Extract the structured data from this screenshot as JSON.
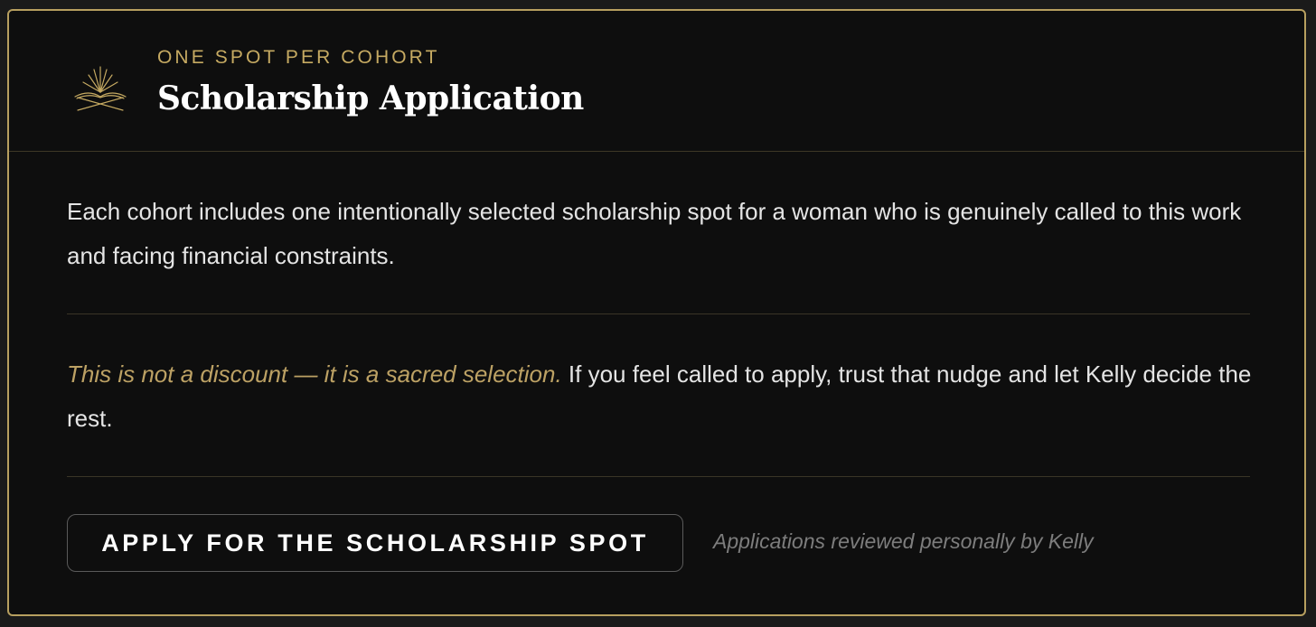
{
  "header": {
    "icon": "open-book-icon",
    "eyebrow": "ONE SPOT PER COHORT",
    "title": "Scholarship Application"
  },
  "content": {
    "intro": "Each cohort includes one intentionally selected scholarship spot for a woman who is genuinely called to this work and facing financial constraints.",
    "emphasis": "This is not a discount — it is a sacred selection.",
    "body": " If you feel called to apply, trust that nudge and let Kelly decide the rest."
  },
  "cta": {
    "button_label": "APPLY FOR THE SCHOLARSHIP SPOT",
    "note": "Applications reviewed personally by Kelly"
  },
  "colors": {
    "accent": "#c6aa62",
    "background": "#0e0e0e",
    "text": "#e4e4e4",
    "muted": "#7d7d7d"
  }
}
